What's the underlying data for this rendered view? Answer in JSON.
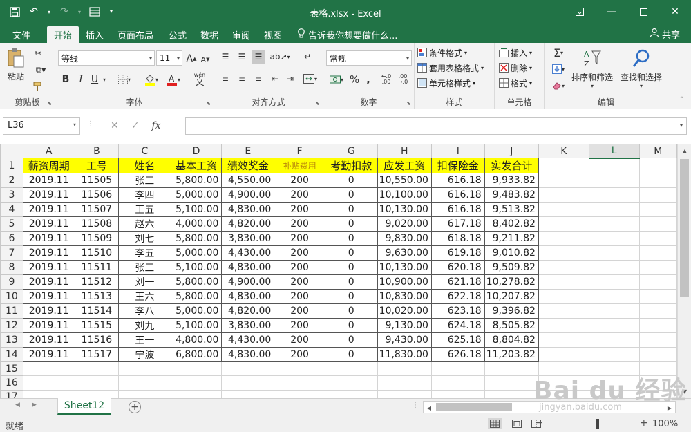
{
  "app": {
    "title": "表格.xlsx - Excel",
    "accent_color": "#217346",
    "window_buttons": [
      "restore-icon",
      "minimize-icon",
      "maximize-icon",
      "close-icon"
    ]
  },
  "menu": {
    "tabs": [
      "文件",
      "开始",
      "插入",
      "页面布局",
      "公式",
      "数据",
      "审阅",
      "视图"
    ],
    "active_tab": "开始",
    "tell_me": "告诉我你想要做什么...",
    "share": "共享"
  },
  "ribbon": {
    "clipboard": {
      "label": "剪贴板",
      "paste": "粘贴"
    },
    "font": {
      "label": "字体",
      "font_name": "等线",
      "font_size": "11",
      "bold": "B",
      "italic": "I",
      "underline": "U",
      "grow": "A",
      "shrink": "A",
      "wen": "wén",
      "wen_char": "文"
    },
    "alignment": {
      "label": "对齐方式"
    },
    "number": {
      "label": "数字",
      "format": "常规",
      "percent": "%",
      "comma": ","
    },
    "styles": {
      "label": "样式",
      "conditional": "条件格式",
      "table": "套用表格格式",
      "cell": "单元格样式"
    },
    "cells": {
      "label": "单元格",
      "insert": "插入",
      "delete": "删除",
      "format": "格式"
    },
    "editing": {
      "label": "编辑",
      "sort": "排序和筛选",
      "find": "查找和选择"
    }
  },
  "formula_bar": {
    "name_box": "L36",
    "fx": "fx",
    "content": ""
  },
  "sheet": {
    "columns": [
      "A",
      "B",
      "C",
      "D",
      "E",
      "F",
      "G",
      "H",
      "I",
      "J",
      "K",
      "L",
      "M"
    ],
    "selected_column": "L",
    "row_numbers": [
      "1",
      "2",
      "3",
      "4",
      "5",
      "6",
      "7",
      "8",
      "9",
      "10",
      "11",
      "12",
      "13",
      "14",
      "15",
      "16",
      "17"
    ],
    "header_fill": "#ffff00",
    "headers": [
      "薪资周期",
      "工号",
      "姓名",
      "基本工资",
      "绩效奖金",
      "补贴费用",
      "考勤扣款",
      "应发工资",
      "扣保险金",
      "实发合计"
    ],
    "rows": [
      [
        "2019.11",
        "11505",
        "张三",
        "5,800.00",
        "4,550.00",
        "200",
        "0",
        "10,550.00",
        "616.18",
        "9,933.82"
      ],
      [
        "2019.11",
        "11506",
        "李四",
        "5,000.00",
        "4,900.00",
        "200",
        "0",
        "10,100.00",
        "616.18",
        "9,483.82"
      ],
      [
        "2019.11",
        "11507",
        "王五",
        "5,100.00",
        "4,830.00",
        "200",
        "0",
        "10,130.00",
        "616.18",
        "9,513.82"
      ],
      [
        "2019.11",
        "11508",
        "赵六",
        "4,000.00",
        "4,820.00",
        "200",
        "0",
        "9,020.00",
        "617.18",
        "8,402.82"
      ],
      [
        "2019.11",
        "11509",
        "刘七",
        "5,800.00",
        "3,830.00",
        "200",
        "0",
        "9,830.00",
        "618.18",
        "9,211.82"
      ],
      [
        "2019.11",
        "11510",
        "李五",
        "5,000.00",
        "4,430.00",
        "200",
        "0",
        "9,630.00",
        "619.18",
        "9,010.82"
      ],
      [
        "2019.11",
        "11511",
        "张三",
        "5,100.00",
        "4,830.00",
        "200",
        "0",
        "10,130.00",
        "620.18",
        "9,509.82"
      ],
      [
        "2019.11",
        "11512",
        "刘一",
        "5,800.00",
        "4,900.00",
        "200",
        "0",
        "10,900.00",
        "621.18",
        "10,278.82"
      ],
      [
        "2019.11",
        "11513",
        "王六",
        "5,800.00",
        "4,830.00",
        "200",
        "0",
        "10,830.00",
        "622.18",
        "10,207.82"
      ],
      [
        "2019.11",
        "11514",
        "李八",
        "5,000.00",
        "4,820.00",
        "200",
        "0",
        "10,020.00",
        "623.18",
        "9,396.82"
      ],
      [
        "2019.11",
        "11515",
        "刘九",
        "5,100.00",
        "3,830.00",
        "200",
        "0",
        "9,130.00",
        "624.18",
        "8,505.82"
      ],
      [
        "2019.11",
        "11516",
        "王一",
        "4,800.00",
        "4,430.00",
        "200",
        "0",
        "9,430.00",
        "625.18",
        "8,804.82"
      ],
      [
        "2019.11",
        "11517",
        "宁波",
        "6,800.00",
        "4,830.00",
        "200",
        "0",
        "11,830.00",
        "626.18",
        "11,203.82"
      ]
    ]
  },
  "sheet_tabs": {
    "active": "Sheet12",
    "add": "+"
  },
  "status": {
    "text": "就绪",
    "zoom": "100%",
    "zoom_minus": "−",
    "zoom_plus": "+"
  },
  "watermark": {
    "brand": "Bai du 经验",
    "url": "jingyan.baidu.com"
  }
}
